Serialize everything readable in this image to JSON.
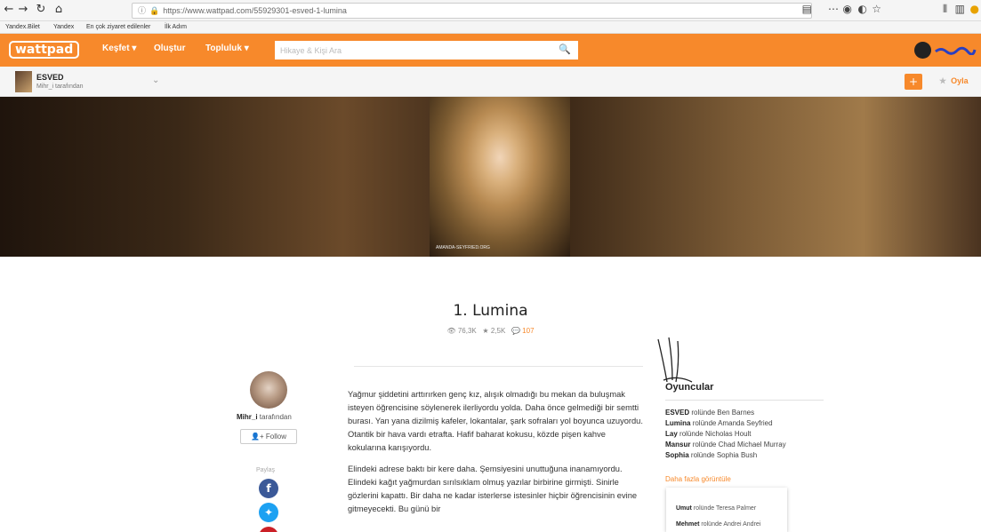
{
  "browser": {
    "url": "https://www.wattpad.com/55929301-esved-1-lumina",
    "bookmarks": [
      "Yandex.Bilet",
      "Yandex",
      "En çok ziyaret edilenler",
      "İlk Adım"
    ]
  },
  "header": {
    "logo": "wattpad",
    "nav": [
      "Keşfet ▾",
      "Oluştur",
      "Topluluk ▾"
    ],
    "search_placeholder": "Hikaye & Kişi Ara"
  },
  "story_bar": {
    "title": "ESVED",
    "author": "Mihr_i tarafından",
    "add_label": "+",
    "vote_label": "Oyla"
  },
  "banner": {
    "caption": "AMANDA-SEYFRIED.ORG"
  },
  "chapter": {
    "title": "1. Lumina",
    "reads": "76,3K",
    "votes": "2,5K",
    "comments": "107"
  },
  "author_panel": {
    "name": "Mihr_i",
    "suffix": "tarafından",
    "follow_label": "Follow",
    "share_label": "Paylaş"
  },
  "story_text": [
    "Yağmur şiddetini arttırırken genç kız, alışık olmadığı bu mekan da buluşmak isteyen öğrencisine söylenerek ilerliyordu yolda. Daha önce gelmediği bir semtti burası. Yan yana dizilmiş kafeler, lokantalar, şark sofraları yol boyunca uzuyordu. Otantik bir hava vardı etrafta. Hafif baharat kokusu, közde pişen kahve kokularına karışıyordu.",
    "Elindeki adrese baktı bir kere daha. Şemsiyesini unuttuğuna inanamıyordu. Elindeki kağıt yağmurdan sırılsıklam olmuş yazılar birbirine girmişti. Sinirle gözlerini kapattı. Bir daha ne kadar isterlerse istesinler hiçbir öğrencisinin evine gitmeyecekti. Bu günü bir"
  ],
  "cast": {
    "title": "Oyuncular",
    "connector": "rolünde",
    "members": [
      {
        "character": "ESVED",
        "actor": "Ben Barnes"
      },
      {
        "character": "Lumina",
        "actor": "Amanda Seyfried"
      },
      {
        "character": "Lay",
        "actor": "Nicholas Hoult"
      },
      {
        "character": "Mansur",
        "actor": "Chad Michael Murray"
      },
      {
        "character": "Sophia",
        "actor": "Sophia Bush"
      }
    ],
    "more_label": "Daha fazla görüntüle",
    "popup": [
      {
        "character": "Umut",
        "actor": "Teresa Palmer"
      },
      {
        "character": "Mehmet",
        "actor": "Andrei Andrei"
      }
    ]
  },
  "colors": {
    "accent": "#f7892b"
  }
}
